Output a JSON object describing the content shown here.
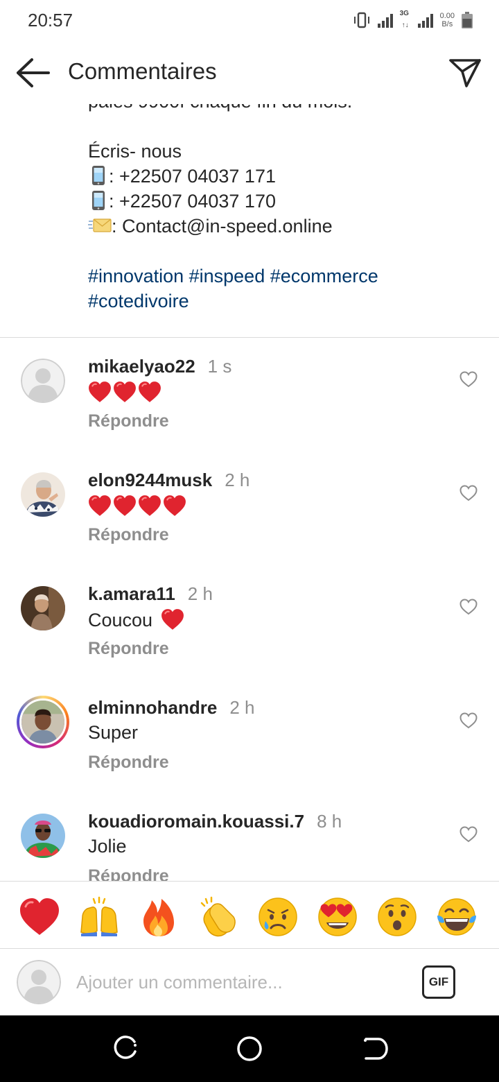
{
  "status_bar": {
    "time": "20:57",
    "network_type": "3G",
    "net_speed_value": "0.00",
    "net_speed_unit": "B/s"
  },
  "header": {
    "title": "Commentaires"
  },
  "caption": {
    "cut_line": "paies 9900f chaque fin du mois.",
    "write_us": "Écris- nous",
    "phone_1": ": +22507 04037 171",
    "phone_2": ": +22507 04037 170",
    "email": ": Contact@in-speed.online",
    "hashtags_line_1": "#innovation #inspeed #ecommerce",
    "hashtags_line_2": "#cotedivoire",
    "link_color": "#00376b"
  },
  "comments": [
    {
      "username": "mikaelyao22",
      "time": "1 s",
      "text": "",
      "hearts": 3,
      "reply_label": "Répondre"
    },
    {
      "username": "elon9244musk",
      "time": "2 h",
      "text": "",
      "hearts": 4,
      "reply_label": "Répondre"
    },
    {
      "username": "k.amara11",
      "time": "2 h",
      "text": "Coucou",
      "hearts": 1,
      "reply_label": "Répondre"
    },
    {
      "username": "elminnohandre",
      "time": "2 h",
      "text": "Super",
      "hearts": 0,
      "reply_label": "Répondre",
      "story_ring": true
    },
    {
      "username": "kouadioromain.kouassi.7",
      "time": "8 h",
      "text": "Jolie",
      "hearts": 0,
      "reply_label": "Répondre"
    }
  ],
  "emoji_bar": [
    "red-heart",
    "raising-hands",
    "fire",
    "clapping-hands",
    "sad-but-relieved-face",
    "heart-eyes-face",
    "hushed-face",
    "tears-of-joy-face"
  ],
  "composer": {
    "placeholder": "Ajouter un commentaire...",
    "gif_label": "GIF"
  },
  "colors": {
    "heart_red": "#e0242f",
    "muted_text": "#8e8e8e",
    "divider": "#dbdbdb"
  }
}
